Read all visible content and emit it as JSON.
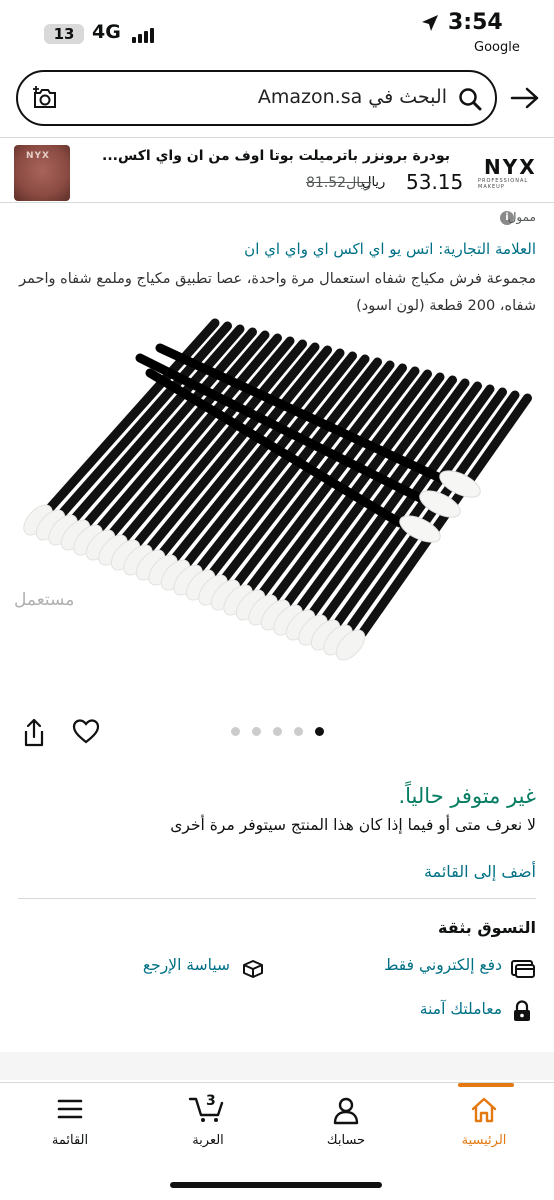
{
  "status_bar": {
    "battery": "13",
    "network": "4G",
    "time": "3:54",
    "back_app": "Google"
  },
  "search": {
    "placeholder": "البحث في Amazon.sa"
  },
  "sponsored_strip": {
    "brand_logo": "NYX",
    "brand_logo_sub": "PROFESSIONAL MAKEUP",
    "product_thumb_text": "NYX",
    "title": "بودرة برونزر باترميلت بوتا اوف من ان واي اكس...",
    "price": "53.15",
    "currency": "ريال",
    "old_price": "81.52ريال"
  },
  "sponsored_label": "ممول",
  "product": {
    "brand": "العلامة التجارية: اتس يو اي اكس اي واي اي ان",
    "title": "مجموعة فرش مكياج شفاه استعمال مرة واحدة، عصا تطبيق مكياج وملمع شفاه واحمر شفاه، 200 قطعة (لون اسود)",
    "watermark": "مستعمل",
    "image_count": 5,
    "current_image": 1
  },
  "availability": {
    "status": "غير متوفر حالياً.",
    "note": "لا نعرف متى أو فيما إذا كان هذا المنتج سيتوفر مرة أخرى",
    "add_to_list": "أضف إلى القائمة"
  },
  "trust": {
    "title": "التسوق بثقة",
    "electronic_payment": "دفع إلكتروني فقط",
    "return_policy": "سياسة الإرجع",
    "secure_transaction": "معاملتك آمنة"
  },
  "tabs": {
    "home": "الرئيسية",
    "account": "حسابك",
    "cart": "العربة",
    "cart_count": "3",
    "menu": "القائمة"
  },
  "colors": {
    "link": "#007185",
    "available_green": "#067d62",
    "accent_orange": "#e47911"
  }
}
